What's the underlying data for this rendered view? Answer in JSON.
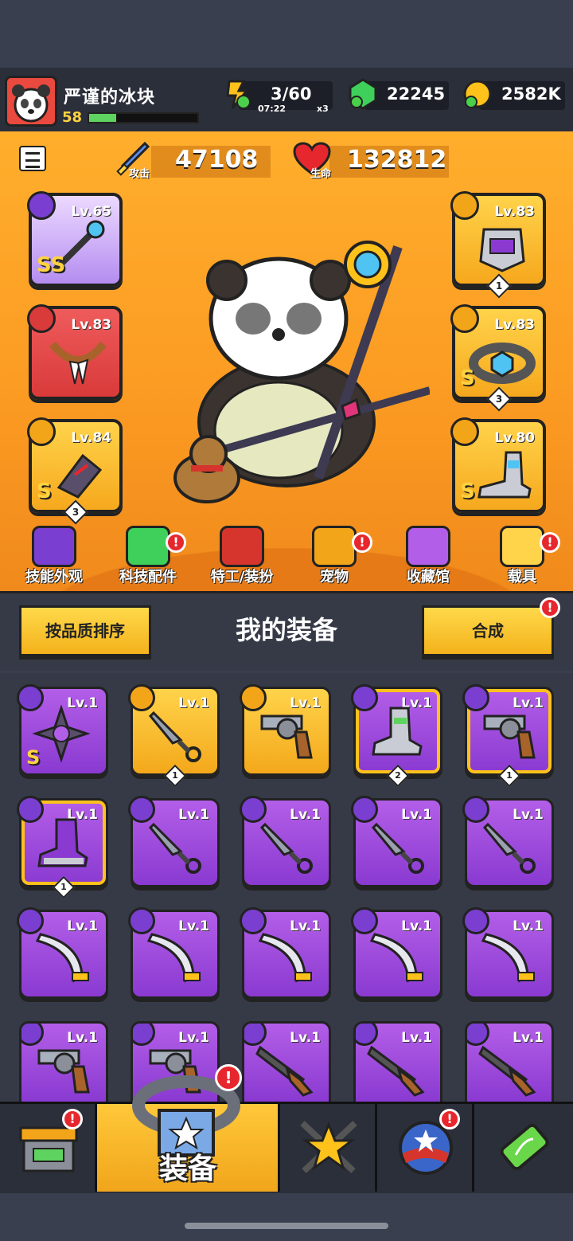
{
  "player": {
    "name": "严谨的冰块",
    "level": "58",
    "xp_fraction": 0.25
  },
  "resources": {
    "energy": {
      "value": "3/60",
      "timer": "07:22",
      "multiplier": "x3",
      "icon": "energy-lightning-icon"
    },
    "gems": {
      "value": "22245",
      "icon": "green-gem-icon"
    },
    "coins": {
      "value": "2582K",
      "icon": "gold-coin-icon"
    }
  },
  "stats": {
    "attack": {
      "label": "攻击",
      "value": "47108",
      "icon": "sword-icon"
    },
    "health": {
      "label": "生命",
      "value": "132812",
      "icon": "heart-icon"
    }
  },
  "equipped": {
    "weapon": {
      "level": "Lv.65",
      "grade": "SS",
      "icon": "staff-weapon-icon"
    },
    "necklace": {
      "level": "Lv.83",
      "icon": "fang-necklace-icon"
    },
    "gloves": {
      "level": "Lv.84",
      "grade": "S",
      "stars": "3",
      "icon": "gauntlet-icon"
    },
    "armor": {
      "level": "Lv.83",
      "stars": "1",
      "icon": "armor-icon"
    },
    "belt": {
      "level": "Lv.83",
      "grade": "S",
      "stars": "3",
      "icon": "belt-icon"
    },
    "boots": {
      "level": "Lv.80",
      "grade": "S",
      "icon": "boots-icon"
    }
  },
  "menu": [
    {
      "label": "技能外观",
      "icon": "skill-skin-icon",
      "alert": false
    },
    {
      "label": "科技配件",
      "icon": "tech-part-icon",
      "alert": true
    },
    {
      "label": "特工/装扮",
      "icon": "agent-costume-icon",
      "alert": false
    },
    {
      "label": "宠物",
      "icon": "pet-icon",
      "alert": true
    },
    {
      "label": "收藏馆",
      "icon": "collection-icon",
      "alert": false
    },
    {
      "label": "载具",
      "icon": "vehicle-icon",
      "alert": true
    }
  ],
  "equipment_panel": {
    "sort_label": "按品质排序",
    "title": "我的装备",
    "merge_label": "合成",
    "alert_mark": "!"
  },
  "inventory": [
    {
      "level": "Lv.1",
      "rarity": "purple",
      "item": "shuriken-blade",
      "grade": "S"
    },
    {
      "level": "Lv.1",
      "rarity": "yellow",
      "item": "kunai",
      "stars": "1"
    },
    {
      "level": "Lv.1",
      "rarity": "yellow",
      "item": "revolver"
    },
    {
      "level": "Lv.1",
      "rarity": "purple-gold",
      "item": "boots",
      "stars": "2"
    },
    {
      "level": "Lv.1",
      "rarity": "purple-gold",
      "item": "revolver",
      "stars": "1"
    },
    {
      "level": "Lv.1",
      "rarity": "purple-gold",
      "item": "purple-boots",
      "stars": "1"
    },
    {
      "level": "Lv.1",
      "rarity": "purple",
      "item": "kunai"
    },
    {
      "level": "Lv.1",
      "rarity": "purple",
      "item": "kunai"
    },
    {
      "level": "Lv.1",
      "rarity": "purple",
      "item": "kunai"
    },
    {
      "level": "Lv.1",
      "rarity": "purple",
      "item": "kunai"
    },
    {
      "level": "Lv.1",
      "rarity": "purple",
      "item": "scimitar"
    },
    {
      "level": "Lv.1",
      "rarity": "purple",
      "item": "scimitar"
    },
    {
      "level": "Lv.1",
      "rarity": "purple",
      "item": "scimitar"
    },
    {
      "level": "Lv.1",
      "rarity": "purple",
      "item": "scimitar"
    },
    {
      "level": "Lv.1",
      "rarity": "purple",
      "item": "scimitar"
    },
    {
      "level": "Lv.1",
      "rarity": "purple",
      "item": "revolver"
    },
    {
      "level": "Lv.1",
      "rarity": "purple",
      "item": "revolver"
    },
    {
      "level": "Lv.1",
      "rarity": "purple",
      "item": "shotgun"
    },
    {
      "level": "Lv.1",
      "rarity": "purple",
      "item": "shotgun"
    },
    {
      "level": "Lv.1",
      "rarity": "purple",
      "item": "shotgun"
    }
  ],
  "bottom_nav": [
    {
      "label": "",
      "icon": "shop-icon",
      "alert": true
    },
    {
      "label": "装备",
      "icon": "equipment-belt-icon",
      "alert": true,
      "active": true
    },
    {
      "label": "",
      "icon": "star-battle-icon",
      "alert": false
    },
    {
      "label": "",
      "icon": "star-ball-icon",
      "alert": true
    },
    {
      "label": "",
      "icon": "dna-capsule-icon",
      "alert": false
    }
  ],
  "colors": {
    "accent_yellow": "#ffd34a",
    "rare_purple": "#a64fe0",
    "alert_red": "#e6272d",
    "panel_bg": "#353a46"
  }
}
